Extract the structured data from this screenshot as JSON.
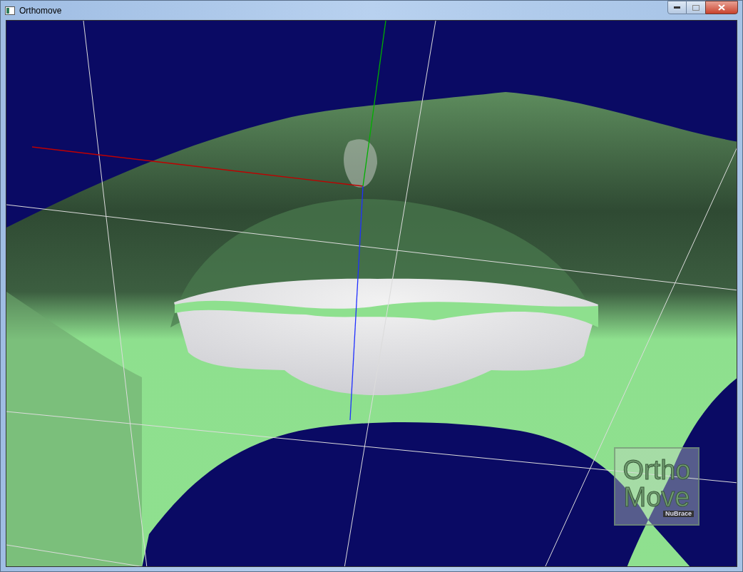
{
  "window": {
    "title": "Orthomove"
  },
  "logo": {
    "line_1": "Ortho",
    "line_2": "Move",
    "brand": "NuBrace"
  }
}
